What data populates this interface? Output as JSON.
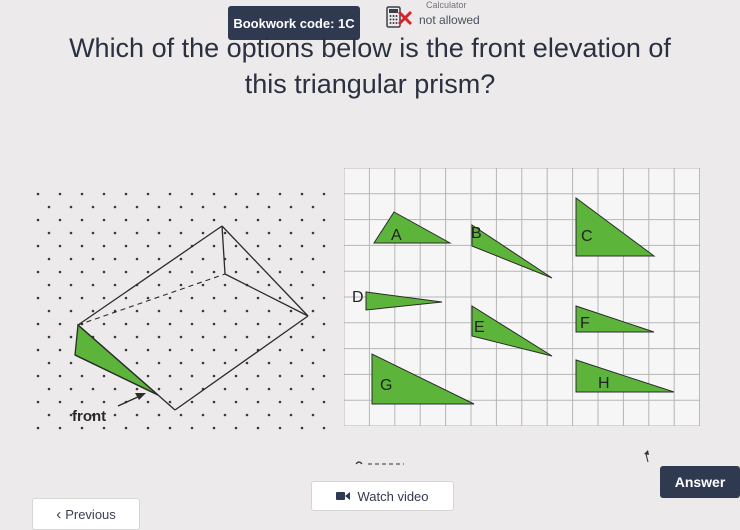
{
  "header": {
    "bookwork_code": "Bookwork code: 1C",
    "calculator_label": "Calculator",
    "calculator_status": "not allowed",
    "calculator_icon": "calculator-crossed-icon"
  },
  "question": {
    "line1": "Which of the options below is the front elevation of",
    "line2": "this triangular prism?"
  },
  "prism": {
    "front_label": "front",
    "face_color": "#5cb53a"
  },
  "options": {
    "A": "A",
    "B": "B",
    "C": "C",
    "D": "D",
    "E": "E",
    "F": "F",
    "G": "G",
    "H": "H"
  },
  "buttons": {
    "watch_video": "Watch video",
    "answer": "Answer",
    "previous": "Previous"
  },
  "colors": {
    "accent": "#2f3a50",
    "triangle_fill": "#5cb53a"
  }
}
